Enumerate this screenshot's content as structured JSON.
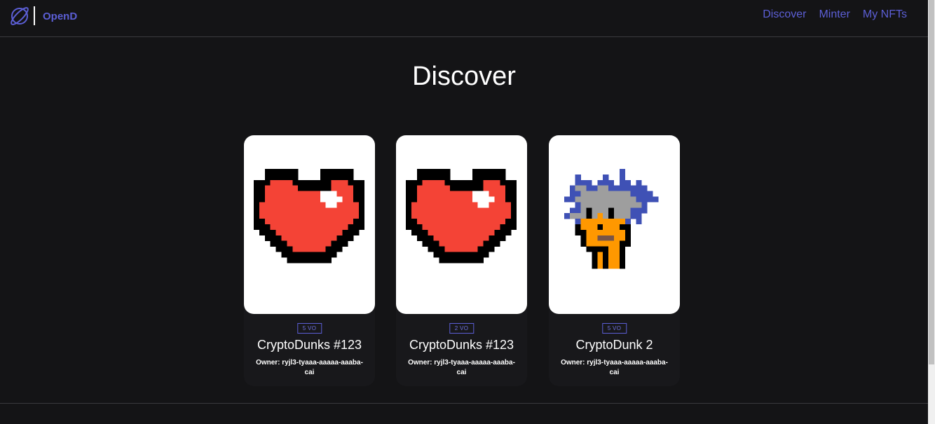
{
  "header": {
    "brand": "OpenD",
    "logo_icon": "planet-icon",
    "nav": [
      "Discover",
      "Minter",
      "My NFTs"
    ],
    "accent_color": "#5c5fd6"
  },
  "main": {
    "title": "Discover",
    "cards": [
      {
        "image": "pixel-heart",
        "price": "5 VO",
        "name": "CryptoDunks #123",
        "owner_label": "Owner: ryjl3-tyaaa-aaaaa-aaaba-cai"
      },
      {
        "image": "pixel-heart",
        "price": "2 VO",
        "name": "CryptoDunks #123",
        "owner_label": "Owner: ryjl3-tyaaa-aaaaa-aaaba-cai"
      },
      {
        "image": "pixel-punk",
        "price": "5 VO",
        "name": "CryptoDunk 2",
        "owner_label": "Owner: ryjl3-tyaaa-aaaaa-aaaba-cai"
      }
    ]
  },
  "colors": {
    "background": "#141416",
    "heart_red": "#f44336",
    "punk_orange": "#ff9800",
    "punk_hair": "#3f51b5",
    "punk_grey": "#9e9e9e"
  }
}
